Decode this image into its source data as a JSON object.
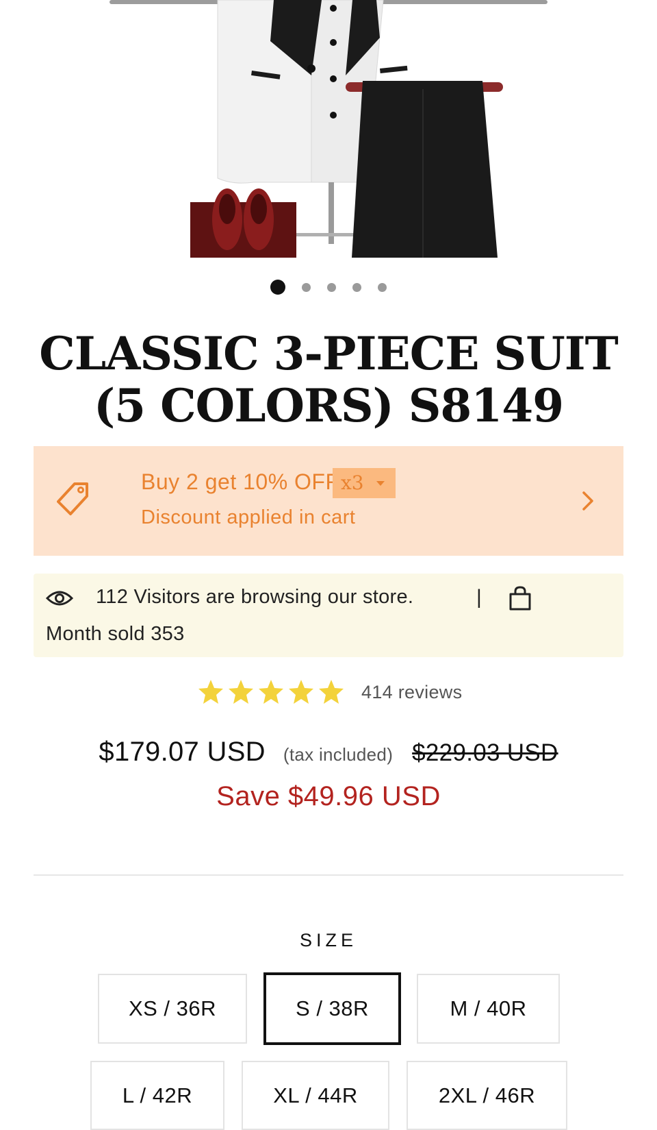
{
  "gallery": {
    "slide_count": 5,
    "active_slide": 1
  },
  "product": {
    "title": "CLASSIC 3-PIECE SUIT (5 COLORS) S8149"
  },
  "offer": {
    "headline": "Buy 2 get 10% OFF",
    "subtext": "Discount applied in cart",
    "quantity_badge": "x3",
    "accent_color": "#e9822f",
    "background_color": "#fde2cd"
  },
  "activity": {
    "visitors_text": "112 Visitors are browsing our store.",
    "separator": "|",
    "sold_text": "Month sold 353"
  },
  "rating": {
    "stars": 5,
    "reviews_text": "414 reviews",
    "star_color": "#f3d23b"
  },
  "pricing": {
    "price": "$179.07 USD",
    "tax_note": "(tax included)",
    "compare_at": "$229.03 USD",
    "savings": "Save $49.96 USD",
    "savings_color": "#b3231f"
  },
  "size_selector": {
    "label": "SIZE",
    "selected": "S / 38R",
    "options": [
      "XS / 36R",
      "S / 38R",
      "M / 40R",
      "L / 42R",
      "XL / 44R",
      "2XL / 46R"
    ]
  }
}
